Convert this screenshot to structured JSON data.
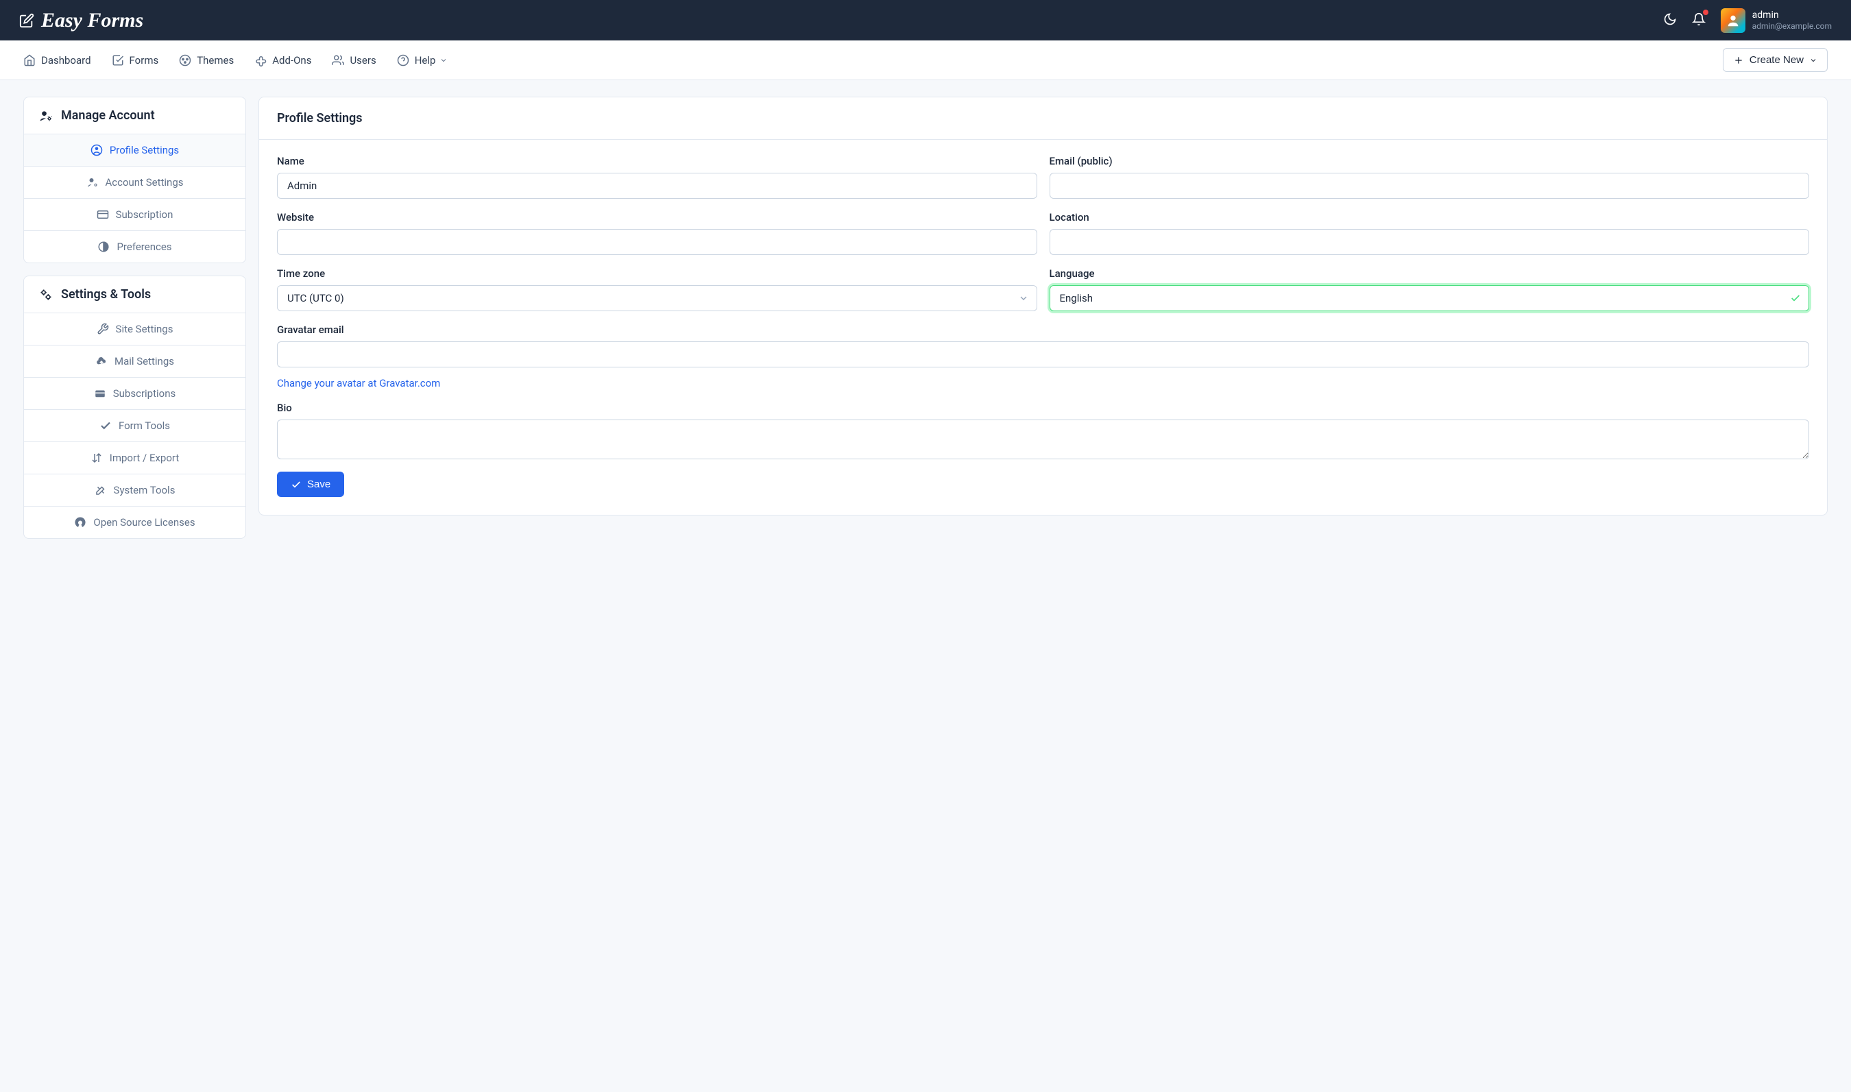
{
  "brand": {
    "name": "Easy Forms"
  },
  "user": {
    "name": "admin",
    "email": "admin@example.com"
  },
  "nav": {
    "items": [
      {
        "label": "Dashboard"
      },
      {
        "label": "Forms"
      },
      {
        "label": "Themes"
      },
      {
        "label": "Add-Ons"
      },
      {
        "label": "Users"
      },
      {
        "label": "Help"
      }
    ],
    "create_label": "Create New"
  },
  "sidebar": {
    "section1_title": "Manage Account",
    "section1_items": [
      {
        "label": "Profile Settings"
      },
      {
        "label": "Account Settings"
      },
      {
        "label": "Subscription"
      },
      {
        "label": "Preferences"
      }
    ],
    "section2_title": "Settings & Tools",
    "section2_items": [
      {
        "label": "Site Settings"
      },
      {
        "label": "Mail Settings"
      },
      {
        "label": "Subscriptions"
      },
      {
        "label": "Form Tools"
      },
      {
        "label": "Import / Export"
      },
      {
        "label": "System Tools"
      },
      {
        "label": "Open Source Licenses"
      }
    ]
  },
  "content": {
    "title": "Profile Settings",
    "labels": {
      "name": "Name",
      "email": "Email (public)",
      "website": "Website",
      "location": "Location",
      "timezone": "Time zone",
      "language": "Language",
      "gravatar": "Gravatar email",
      "bio": "Bio"
    },
    "values": {
      "name": "Admin",
      "email": "",
      "website": "",
      "location": "",
      "timezone": "UTC (UTC 0)",
      "language": "English",
      "gravatar": "",
      "bio": ""
    },
    "gravatar_link_text": "Change your avatar at Gravatar.com",
    "save_label": "Save"
  }
}
